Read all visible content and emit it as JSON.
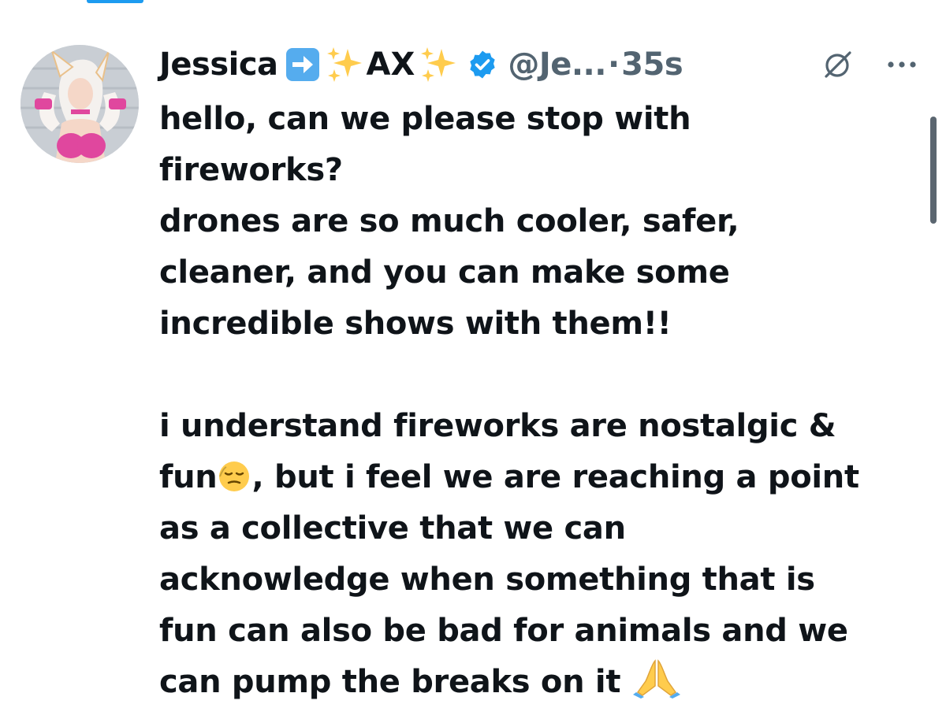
{
  "tweet": {
    "author": {
      "display_name": "Jessica",
      "name_suffix": "AX",
      "handle": "@Je...",
      "verified": true,
      "avatar_icon": "avatar-cosplay-photo"
    },
    "separator": "·",
    "timestamp": "35s",
    "body": {
      "line_1": "hello, can we please stop with",
      "line_2": "fireworks?",
      "line_3": "drones are so much cooler, safer,",
      "line_4": "cleaner, and you can make some",
      "line_5": "incredible shows with them!!",
      "line_6": "i understand fireworks are nostalgic &",
      "line_7a": "fun",
      "line_7b": ", but i feel we are reaching a point",
      "line_8": "as a collective that we can",
      "line_9": "acknowledge when something that is",
      "line_10": "fun can also be bad for animals and we",
      "line_11": "can pump the breaks on it"
    },
    "icons": {
      "arrow": "right-arrow-emoji",
      "sparkles": "sparkles-emoji",
      "verified": "verified-badge-icon",
      "grok": "grok-icon",
      "more": "more-options-icon",
      "relieved": "relieved-face-emoji",
      "pray": "folded-hands-emoji"
    }
  },
  "colors": {
    "text": "#0f1419",
    "secondary": "#536471",
    "accent": "#1d9bf0"
  }
}
